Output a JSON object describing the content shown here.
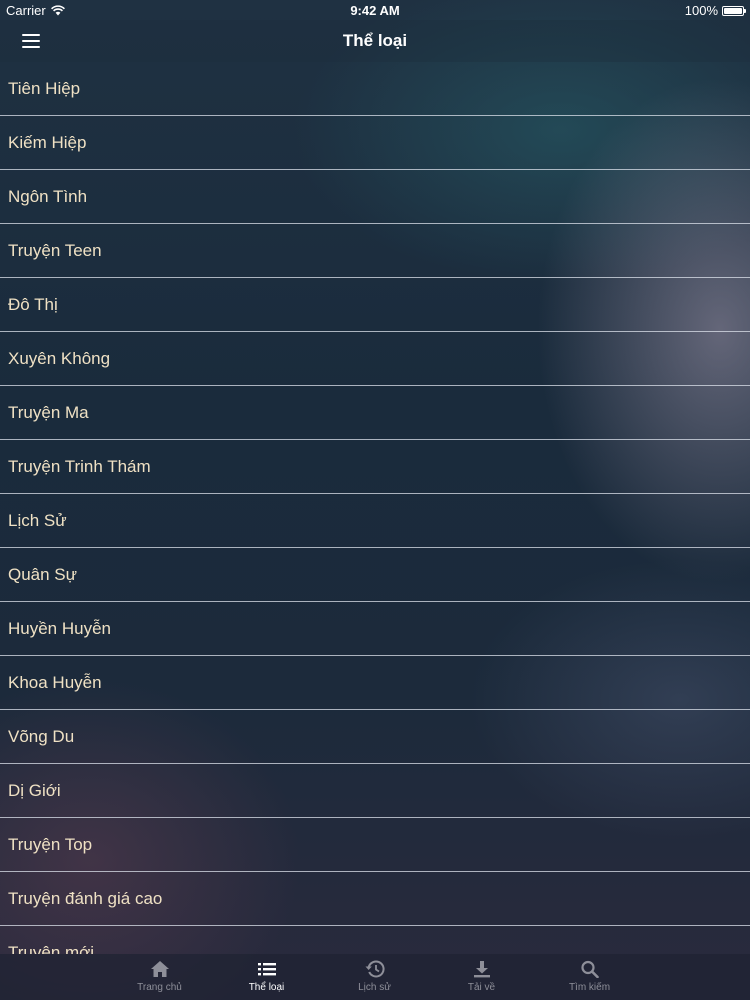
{
  "status_bar": {
    "carrier": "Carrier",
    "time": "9:42 AM",
    "battery": "100%"
  },
  "nav": {
    "title": "Thể loại",
    "menu_icon": "hamburger-menu-icon"
  },
  "categories": [
    "Tiên Hiệp",
    "Kiếm Hiệp",
    "Ngôn Tình",
    "Truyện Teen",
    "Đô Thị",
    "Xuyên Không",
    "Truyện Ma",
    "Truyện Trinh Thám",
    "Lịch Sử",
    "Quân Sự",
    "Huyền Huyễn",
    "Khoa Huyễn",
    "Võng Du",
    "Dị Giới",
    "Truyện Top",
    "Truyện đánh giá cao",
    "Truyện mới"
  ],
  "tabs": [
    {
      "label": "Trang chủ",
      "icon": "home-icon",
      "active": false
    },
    {
      "label": "Thể loại",
      "icon": "list-icon",
      "active": true
    },
    {
      "label": "Lịch sử",
      "icon": "history-icon",
      "active": false
    },
    {
      "label": "Tải về",
      "icon": "download-icon",
      "active": false
    },
    {
      "label": "Tìm kiếm",
      "icon": "search-icon",
      "active": false
    }
  ],
  "colors": {
    "item_text": "#efe1c4",
    "tab_inactive": "#8e8f99",
    "tab_active": "#ffffff"
  }
}
